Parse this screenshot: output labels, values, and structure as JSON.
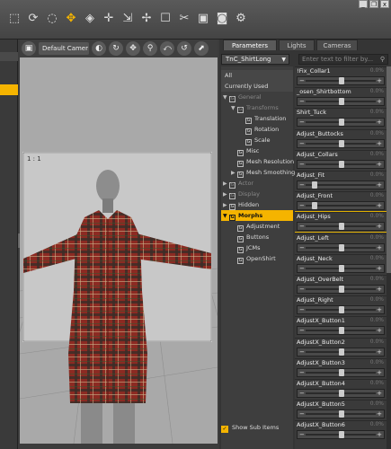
{
  "toolbar": {
    "icons": [
      "select-icon",
      "rotate-icon",
      "lasso-icon",
      "move-icon",
      "node-icon",
      "translate-icon",
      "scale-icon",
      "joint-icon",
      "pose-icon",
      "cloth-icon",
      "render-icon",
      "camera-icon",
      "settings-icon"
    ]
  },
  "window_controls": {
    "minimize": "_",
    "restore": "❐",
    "close": "x"
  },
  "viewport": {
    "camera": "Default Camer",
    "frame_label": "1 : 1"
  },
  "panel": {
    "tabs": [
      "Parameters",
      "Lights",
      "Cameras"
    ],
    "figure": "TnC_ShirtLong",
    "filter_placeholder": "Enter text to filter by...",
    "categories": [
      {
        "label": "All",
        "indent": 0,
        "header": true
      },
      {
        "label": "Currently Used",
        "indent": 0,
        "header": true
      },
      {
        "label": "General",
        "indent": 0,
        "expanded": true,
        "dim": true
      },
      {
        "label": "Transforms",
        "indent": 1,
        "expanded": true,
        "dim": true
      },
      {
        "label": "Translation",
        "indent": 2
      },
      {
        "label": "Rotation",
        "indent": 2
      },
      {
        "label": "Scale",
        "indent": 2
      },
      {
        "label": "Misc",
        "indent": 1
      },
      {
        "label": "Mesh Resolution",
        "indent": 1
      },
      {
        "label": "Mesh Smoothing",
        "indent": 1,
        "collapsed": true
      },
      {
        "label": "Actor",
        "indent": 0,
        "collapsed": true,
        "dim": true
      },
      {
        "label": "Display",
        "indent": 0,
        "collapsed": true,
        "dim": true
      },
      {
        "label": "Hidden",
        "indent": 0,
        "collapsed": true
      },
      {
        "label": "Morphs",
        "indent": 0,
        "expanded": true,
        "selected": true
      },
      {
        "label": "Adjustment",
        "indent": 1
      },
      {
        "label": "Buttons",
        "indent": 1
      },
      {
        "label": "JCMs",
        "indent": 1
      },
      {
        "label": "OpenShirt",
        "indent": 1
      }
    ],
    "show_sub_items": "Show Sub Items",
    "properties": [
      {
        "label": "!Fix_Collar1",
        "value": "0.0%",
        "knob": 0.5
      },
      {
        "label": "_osen_Shirtbottom",
        "value": "0.0%",
        "knob": 0.5
      },
      {
        "label": "Shirt_Tuck",
        "value": "0.0%",
        "knob": 0.5
      },
      {
        "label": "Adjust_Buttocks",
        "value": "0.0%",
        "knob": 0.5
      },
      {
        "label": "Adjust_Collars",
        "value": "0.0%",
        "knob": 0.5
      },
      {
        "label": "Adjust_Fit",
        "value": "0.0%",
        "knob": 0.1
      },
      {
        "label": "Adjust_Front",
        "value": "0.0%",
        "knob": 0.1
      },
      {
        "label": "Adjust_Hips",
        "value": "0.0%",
        "knob": 0.5,
        "highlight": true
      },
      {
        "label": "Adjust_Left",
        "value": "0.0%",
        "knob": 0.5
      },
      {
        "label": "Adjust_Neck",
        "value": "0.0%",
        "knob": 0.5
      },
      {
        "label": "Adjust_OverBelt",
        "value": "0.0%",
        "knob": 0.5
      },
      {
        "label": "Adjust_Right",
        "value": "0.0%",
        "knob": 0.5
      },
      {
        "label": "AdjustX_Button1",
        "value": "0.0%",
        "knob": 0.5
      },
      {
        "label": "AdjustX_Button2",
        "value": "0.0%",
        "knob": 0.5
      },
      {
        "label": "AdjustX_Button3",
        "value": "0.0%",
        "knob": 0.5
      },
      {
        "label": "AdjustX_Button4",
        "value": "0.0%",
        "knob": 0.5
      },
      {
        "label": "AdjustX_Button5",
        "value": "0.0%",
        "knob": 0.5
      },
      {
        "label": "AdjustX_Button6",
        "value": "0.0%",
        "knob": 0.5
      }
    ]
  },
  "colors": {
    "accent": "#f5b400",
    "shirt_red": "#8c2a22",
    "shirt_dark": "#3a2e28"
  }
}
